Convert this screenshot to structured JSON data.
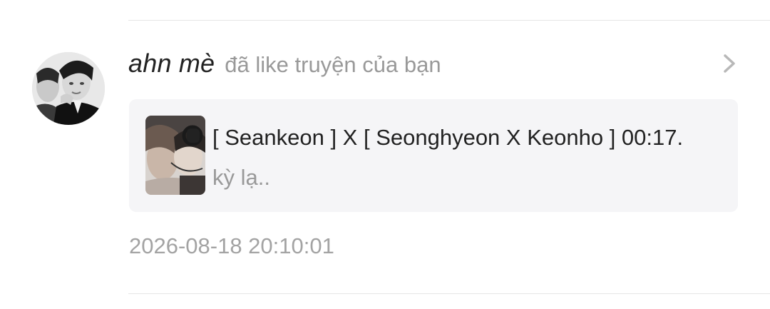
{
  "notification": {
    "username": "ahn mè",
    "action_text": "đã like truyện của bạn",
    "story": {
      "title": "[ Seankeon ] X [ Seonghyeon X Keonho ] 00:17.",
      "subtitle": "kỳ lạ.."
    },
    "timestamp": "2026-08-18 20:10:01"
  },
  "icons": {
    "chevron": "chevron-right-icon"
  },
  "colors": {
    "username": "#222222",
    "secondary_text": "#999999",
    "card_background": "#f5f5f7",
    "divider": "#e6e6e6"
  }
}
